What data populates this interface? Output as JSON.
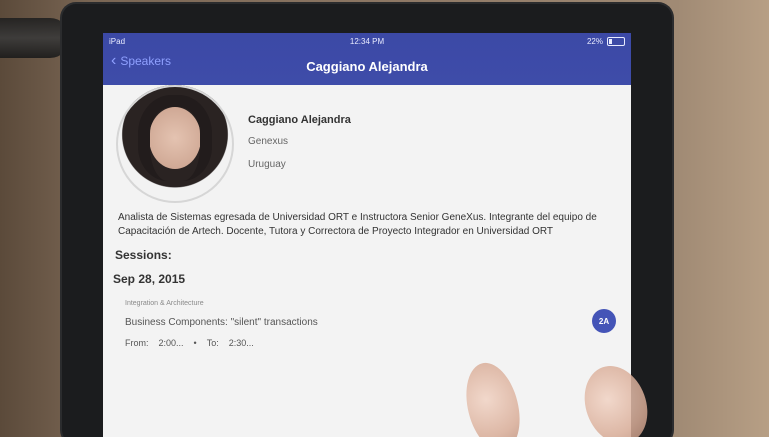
{
  "status": {
    "carrier": "iPad",
    "time": "12:34 PM",
    "battery": "22%"
  },
  "navbar": {
    "back_label": "Speakers",
    "title": "Caggiano Alejandra"
  },
  "speaker": {
    "name": "Caggiano Alejandra",
    "company": "Genexus",
    "country": "Uruguay",
    "bio_line1": "Analista de Sistemas egresada de Universidad ORT e Instructora Senior GeneXus. Integrante del equipo de",
    "bio_line2": "Capacitación de Artech. Docente, Tutora y Correctora de Proyecto Integrador en Universidad ORT"
  },
  "sessions": {
    "heading": "Sessions:",
    "date": "Sep 28, 2015",
    "items": [
      {
        "track": "Integration & Architecture",
        "title": "Business Components: \"silent\" transactions",
        "from_label": "From:",
        "from_time": "2:00...",
        "to_label": "To:",
        "to_time": "2:30...",
        "room": "2A"
      }
    ]
  }
}
